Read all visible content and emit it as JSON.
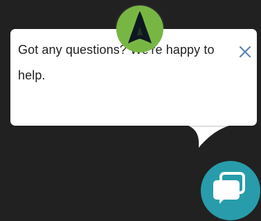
{
  "widget": {
    "message": "Got any questions? We're happy to help.",
    "avatar_icon": "arrowhead-logo-icon",
    "close_icon": "close-icon",
    "launcher_icon": "chat-bubbles-icon"
  },
  "colors": {
    "page_background": "#212121",
    "bubble_background": "#ffffff",
    "text": "#1f1f1f",
    "close_icon": "#5d84ad",
    "avatar_background": "#78b644",
    "avatar_logo": "#0e1720",
    "launcher_background": "#289caa",
    "launcher_icon": "#ffffff"
  }
}
